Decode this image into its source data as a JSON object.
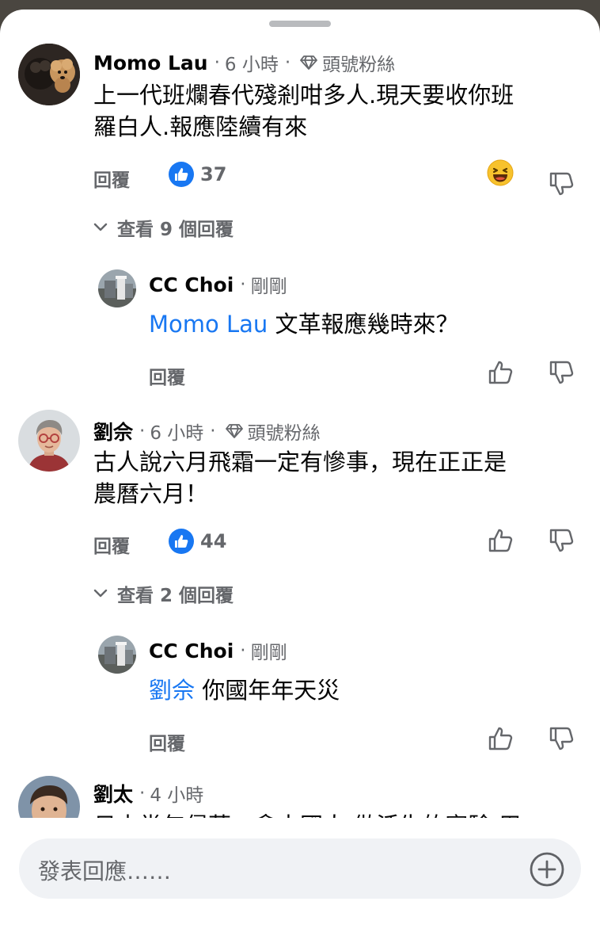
{
  "comments": [
    {
      "author": "Momo Lau",
      "time": "6 小時",
      "badge": "頭號粉絲",
      "line1": "上一代班爛春代殘剎咁多人.現天要收你班",
      "line2": "羅白人.報應陸續有來",
      "reply_label": "回覆",
      "likes": "37",
      "view_replies": "查看 9 個回覆",
      "reply": {
        "author": "CC Choi",
        "time": "剛剛",
        "mention": "Momo Lau",
        "text": " 文革報應幾時來？",
        "reply_label": "回覆"
      }
    },
    {
      "author": "劉佘",
      "time": "6 小時",
      "badge": "頭號粉絲",
      "line1": "古人說六月飛霜一定有慘事，現在正正是",
      "line2": "農曆六月！",
      "reply_label": "回覆",
      "likes": "44",
      "view_replies": "查看 2 個回覆",
      "reply": {
        "author": "CC Choi",
        "time": "剛剛",
        "mention": "劉佘",
        "text": " 你國年年天災",
        "reply_label": "回覆"
      }
    },
    {
      "author": "劉太",
      "time": "4 小時",
      "line1": "日本當年侵華，拿中國人 做活生的實驗 用"
    }
  ],
  "composer": {
    "placeholder": "發表回應……"
  },
  "colors": {
    "accent": "#1877f2",
    "muted": "#65676b"
  },
  "icons": {
    "reaction": "grinning-face-icon",
    "like": "thumbs-up-icon",
    "dislike": "thumbs-down-icon",
    "badge": "diamond-icon",
    "expand": "chevron-down-icon",
    "add": "plus-circle-icon"
  }
}
